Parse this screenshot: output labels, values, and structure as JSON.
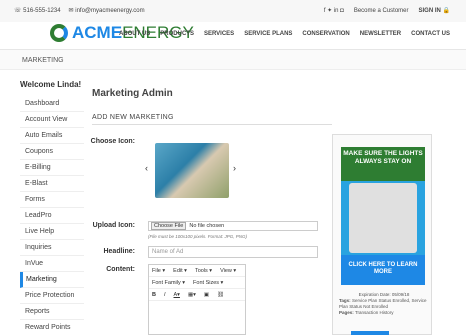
{
  "top": {
    "phone": "516-555-1234",
    "email": "info@myacmeenergy.com",
    "become": "Become a Customer",
    "signin": "SIGN IN"
  },
  "logo": {
    "acme": "ACME",
    "energy": "ENERGY"
  },
  "nav": [
    "ABOUT US",
    "PRODUCTS",
    "SERVICES",
    "SERVICE PLANS",
    "CONSERVATION",
    "NEWSLETTER",
    "CONTACT US"
  ],
  "breadcrumb": "MARKETING",
  "sidebar": {
    "welcome": "Welcome Linda!",
    "items": [
      "Dashboard",
      "Account View",
      "Auto Emails",
      "Coupons",
      "E-Billing",
      "E-Blast",
      "Forms",
      "LeadPro",
      "Live Help",
      "Inquiries",
      "InVue",
      "Marketing",
      "Price Protection",
      "Reports",
      "Reward Points"
    ]
  },
  "main": {
    "title": "Marketing Admin",
    "subtitle": "ADD NEW MARKETING",
    "choose_icon": "Choose Icon:",
    "upload_icon": "Upload Icon:",
    "file_btn": "Choose File",
    "file_none": "No file chosen",
    "hint": "(File must be 100x100 pixels. Format: JPG, PNG)",
    "headline_label": "Headline:",
    "headline_placeholder": "Name of Ad",
    "content_label": "Content:",
    "editor_menu": [
      "File ▾",
      "Edit ▾",
      "Tools ▾",
      "View ▾"
    ],
    "editor_fonts": [
      "Font Family ▾",
      "Font Sizes ▾"
    ]
  },
  "ad": {
    "top": "MAKE SURE THE LIGHTS ALWAYS STAY ON",
    "cta": "CLICK HERE TO LEARN MORE",
    "expire": "Expiration Date: 05/09/18",
    "tags_label": "Tags:",
    "tags": "Service Plan Status Enrolled, Service Plan Status Not Enrolled",
    "pages_label": "Pages:",
    "pages": "Transaction History"
  }
}
